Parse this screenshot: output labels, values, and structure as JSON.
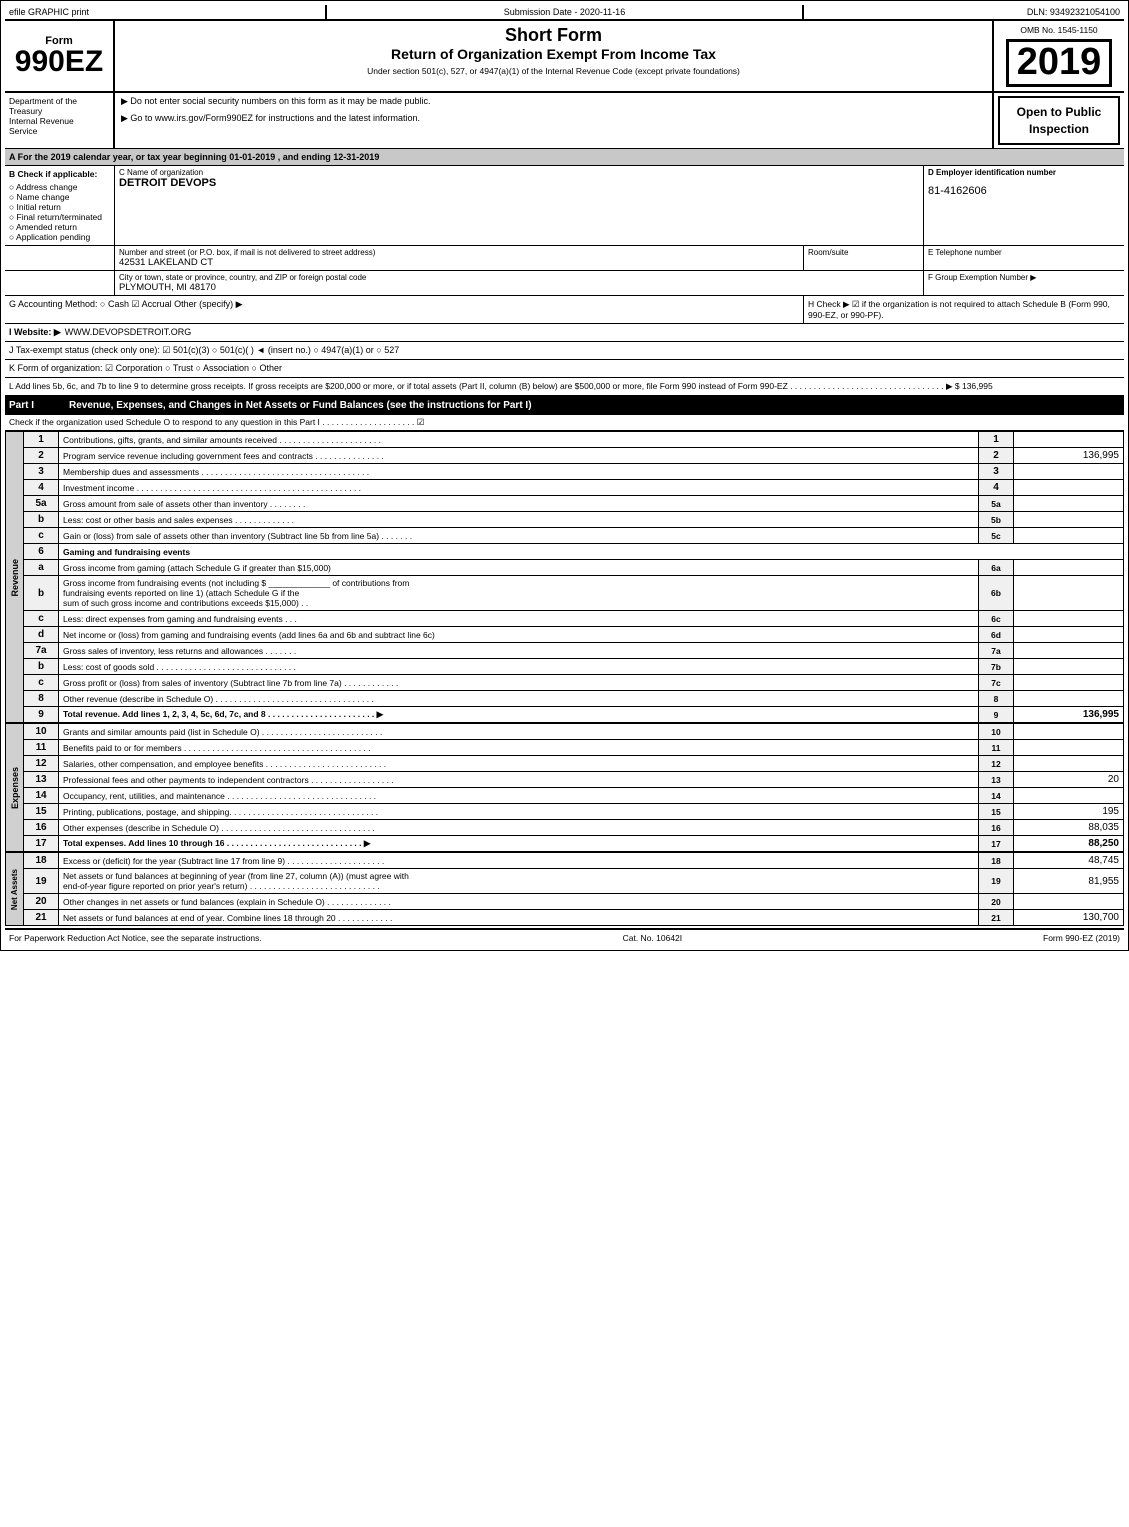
{
  "header": {
    "efile": "efile GRAPHIC print",
    "submission_date_label": "Submission Date - 2020-11-16",
    "dln": "DLN: 93492321054100",
    "form_number": "990EZ",
    "form_short": "Short Form",
    "form_title": "Return of Organization Exempt From Income Tax",
    "subtitle": "Under section 501(c), 527, or 4947(a)(1) of the Internal Revenue Code (except private foundations)",
    "omb": "OMB No. 1545-1150",
    "year": "2019",
    "dept1": "Department of the Treasury",
    "dept2": "Internal Revenue",
    "dept3": "Service",
    "instr1": "▶ Do not enter social security numbers on this form as it may be made public.",
    "instr2": "▶ Go to www.irs.gov/Form990EZ for instructions and the latest information.",
    "open_to_public": "Open to Public Inspection"
  },
  "section_a": {
    "text": "A  For the 2019 calendar year, or tax year beginning 01-01-2019 , and ending 12-31-2019"
  },
  "org": {
    "b_label": "B  Check if applicable:",
    "address_change": "○ Address change",
    "name_change": "○ Name change",
    "initial_return": "○ Initial return",
    "final_return": "○ Final return/terminated",
    "amended_return": "○ Amended return",
    "application_pending": "○ Application pending",
    "c_label": "C Name of organization",
    "c_value": "DETROIT DEVOPS",
    "d_label": "D Employer identification number",
    "d_value": "81-4162606",
    "address_label": "Number and street (or P.O. box, if mail is not delivered to street address)",
    "address_value": "42531 LAKELAND CT",
    "room_label": "Room/suite",
    "phone_label": "E Telephone number",
    "city_label": "City or town, state or province, country, and ZIP or foreign postal code",
    "city_value": "PLYMOUTH, MI  48170",
    "group_label": "F Group Exemption Number ▶"
  },
  "section_g": {
    "text": "G Accounting Method:  ○ Cash  ☑ Accrual  Other (specify) ▶",
    "h_text": "H  Check ▶  ☑ if the organization is not required to attach Schedule B (Form 990, 990-EZ, or 990-PF)."
  },
  "website": {
    "label": "I Website: ▶",
    "value": "WWW.DEVOPSDETROIT.ORG"
  },
  "tax_status": {
    "text": "J Tax-exempt status (check only one): ☑ 501(c)(3) ○ 501(c)(  ) ◄ (insert no.) ○ 4947(a)(1) or ○ 527"
  },
  "k_row": {
    "text": "K Form of organization: ☑ Corporation  ○ Trust  ○ Association  ○ Other"
  },
  "l_row": {
    "text": "L Add lines 5b, 6c, and 7b to line 9 to determine gross receipts. If gross receipts are $200,000 or more, or if total assets (Part II, column (B) below) are $500,000 or more, file Form 990 instead of Form 990-EZ . . . . . . . . . . . . . . . . . . . . . . . . . . . . . . . . . ▶ $ 136,995"
  },
  "part1": {
    "label": "Part I",
    "title": "Revenue, Expenses, and Changes in Net Assets or Fund Balances (see the instructions for Part I)",
    "check_schedule": "Check if the organization used Schedule O to respond to any question in this Part I . . . . . . . . . . . . . . . . . . . . ☑"
  },
  "revenue_lines": [
    {
      "num": "1",
      "desc": "Contributions, gifts, grants, and similar amounts received . . . . . . . . . . . . . . . . . . . . . .",
      "value": ""
    },
    {
      "num": "2",
      "desc": "Program service revenue including government fees and contracts . . . . . . . . . . . . . . .",
      "value": "136,995"
    },
    {
      "num": "3",
      "desc": "Membership dues and assessments . . . . . . . . . . . . . . . . . . . . . . . . . . . . . . . . . . . .",
      "value": ""
    },
    {
      "num": "4",
      "desc": "Investment income . . . . . . . . . . . . . . . . . . . . . . . . . . . . . . . . . . . . . . . . . . . . . . . .",
      "value": ""
    }
  ],
  "line5a": {
    "desc": "Gross amount from sale of assets other than inventory . . . . . . . .",
    "label": "5a",
    "value": ""
  },
  "line5b": {
    "desc": "Less: cost or other basis and sales expenses . . . . . . . . . . . . .",
    "label": "5b",
    "value": ""
  },
  "line5c": {
    "desc": "Gain or (loss) from sale of assets other than inventory (Subtract line 5b from line 5a) . . . . . . .",
    "num": "5c",
    "value": ""
  },
  "line6_header": {
    "desc": "Gaming and fundraising events"
  },
  "line6a": {
    "desc": "Gross income from gaming (attach Schedule G if greater than $15,000)",
    "label": "6a",
    "value": ""
  },
  "line6b_desc": "Gross income from fundraising events (not including $ _____________ of contributions from fundraising events reported on line 1) (attach Schedule G if the sum of such gross income and contributions exceeds $15,000)",
  "line6b": {
    "label": "6b",
    "value": ""
  },
  "line6c": {
    "desc": "Less: direct expenses from gaming and fundraising events  . . .",
    "label": "6c",
    "value": ""
  },
  "line6d": {
    "desc": "Net income or (loss) from gaming and fundraising events (add lines 6a and 6b and subtract line 6c)",
    "num": "6d",
    "value": ""
  },
  "line7a": {
    "desc": "Gross sales of inventory, less returns and allowances . . . . . . .",
    "label": "7a",
    "value": ""
  },
  "line7b": {
    "desc": "Less: cost of goods sold  . . . . . . . . . . . . . . . . . . . . . . . .",
    "label": "7b",
    "value": ""
  },
  "line7c": {
    "desc": "Gross profit or (loss) from sales of inventory (Subtract line 7b from line 7a) . . . . . . . . . . . .",
    "num": "7c",
    "value": ""
  },
  "line8": {
    "num": "8",
    "desc": "Other revenue (describe in Schedule O) . . . . . . . . . . . . . . . . . . . . . . . . . . . . . . . . . .",
    "value": ""
  },
  "line9": {
    "num": "9",
    "desc": "Total revenue. Add lines 1, 2, 3, 4, 5c, 6d, 7c, and 8 . . . . . . . . . . . . . . . . . . . . . . . ▶",
    "value": "136,995"
  },
  "expenses_lines": [
    {
      "num": "10",
      "desc": "Grants and similar amounts paid (list in Schedule O) . . . . . . . . . . . . . . . . . . . . . . . . . .",
      "value": ""
    },
    {
      "num": "11",
      "desc": "Benefits paid to or for members . . . . . . . . . . . . . . . . . . . . . . . . . . . . . . . . . . . . . . . .",
      "value": ""
    },
    {
      "num": "12",
      "desc": "Salaries, other compensation, and employee benefits . . . . . . . . . . . . . . . . . . . . . . . . . .",
      "value": ""
    },
    {
      "num": "13",
      "desc": "Professional fees and other payments to independent contractors . . . . . . . . . . . . . . . . . .",
      "value": "20"
    },
    {
      "num": "14",
      "desc": "Occupancy, rent, utilities, and maintenance . . . . . . . . . . . . . . . . . . . . . . . . . . . . . . . .",
      "value": ""
    },
    {
      "num": "15",
      "desc": "Printing, publications, postage, and shipping. . . . . . . . . . . . . . . . . . . . . . . . . . . . . . . .",
      "value": "195"
    },
    {
      "num": "16",
      "desc": "Other expenses (describe in Schedule O) . . . . . . . . . . . . . . . . . . . . . . . . . . . . . . . . .",
      "value": "88,035"
    },
    {
      "num": "17",
      "desc": "Total expenses. Add lines 10 through 16  . . . . . . . . . . . . . . . . . . . . . . . . . . . . . ▶",
      "value": "88,250"
    }
  ],
  "net_assets_lines": [
    {
      "num": "18",
      "desc": "Excess or (deficit) for the year (Subtract line 17 from line 9) . . . . . . . . . . . . . . . . . . . . .",
      "value": "48,745"
    },
    {
      "num": "19",
      "desc": "Net assets or fund balances at beginning of year (from line 27, column (A)) (must agree with end-of-year figure reported on prior year's return) . . . . . . . . . . . . . . . . . . . . . . . . . . . .",
      "value": "81,955"
    },
    {
      "num": "20",
      "desc": "Other changes in net assets or fund balances (explain in Schedule O) . . . . . . . . . . . . . .",
      "value": ""
    },
    {
      "num": "21",
      "desc": "Net assets or fund balances at end of year. Combine lines 18 through 20 . . . . . . . . . . . .",
      "value": "130,700"
    }
  ],
  "footer": {
    "paperwork": "For Paperwork Reduction Act Notice, see the separate instructions.",
    "cat_num": "Cat. No. 10642I",
    "form_ref": "Form 990-EZ (2019)"
  }
}
